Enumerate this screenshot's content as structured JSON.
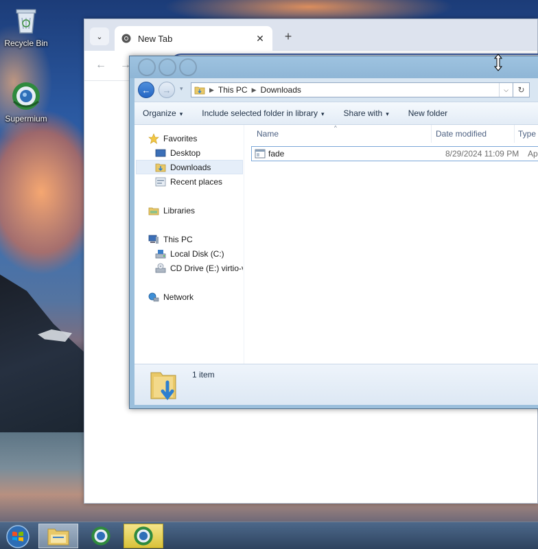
{
  "desktop": {
    "icons": [
      {
        "label": "Recycle Bin",
        "icon": "recycle-bin-icon"
      },
      {
        "label": "Supermium",
        "icon": "supermium-browser-icon"
      }
    ]
  },
  "browser": {
    "tab": {
      "title": "New Tab",
      "close_glyph": "✕"
    },
    "tab_dropdown_glyph": "⌄",
    "newtab_glyph": "+",
    "back_glyph": "←",
    "forward_glyph": "→"
  },
  "explorer": {
    "address": {
      "crumbs": [
        "This PC",
        "Downloads"
      ],
      "back_glyph": "←",
      "forward_glyph": "→",
      "recent_glyph": "▾",
      "dropdown_glyph": "⌵",
      "refresh_glyph": "↻"
    },
    "commands": [
      {
        "label": "Organize",
        "caret": "▾"
      },
      {
        "label": "Include selected folder in library",
        "caret": "▾"
      },
      {
        "label": "Share with",
        "caret": "▾"
      },
      {
        "label": "New folder",
        "caret": ""
      }
    ],
    "nav": {
      "favorites": "Favorites",
      "desktop": "Desktop",
      "downloads": "Downloads",
      "recent": "Recent places",
      "libraries": "Libraries",
      "thispc": "This PC",
      "localdisk": "Local Disk (C:)",
      "cddrive": "CD Drive (E:) virtio-v",
      "network": "Network"
    },
    "columns": {
      "name": "Name",
      "date": "Date modified",
      "type": "Type",
      "sort_glyph": "^"
    },
    "files": [
      {
        "name": "fade",
        "date": "8/29/2024 11:09 PM",
        "type": "Applic"
      }
    ],
    "status": {
      "count": "1 item"
    }
  },
  "colors": {
    "explorer_frame": "#9bbfdc",
    "selection": "#e5eef9",
    "accent_blue": "#2366c4",
    "taskbar_active": "#d9c23a"
  }
}
